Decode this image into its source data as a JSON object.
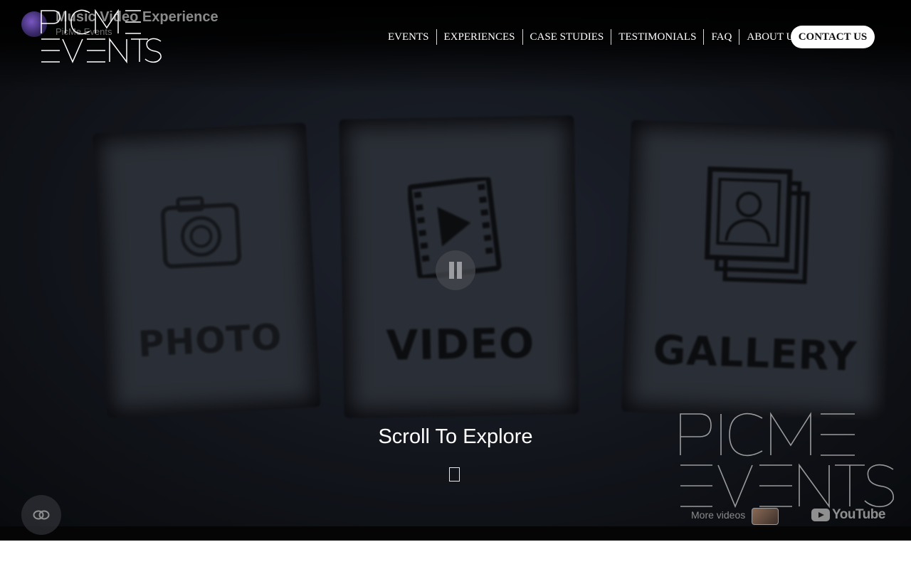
{
  "header": {
    "logo_text_top": "PICME",
    "logo_text_bottom": "EVENTS",
    "nav": [
      "EVENTS",
      "EXPERIENCES",
      "CASE STUDIES",
      "TESTIMONIALS",
      "FAQ",
      "ABOUT US"
    ],
    "contact_label": "CONTACT US"
  },
  "video": {
    "title": "Music Video Experience",
    "channel": "PicMe Events",
    "card_words": [
      "PHOTO",
      "VIDEO",
      "GALLERY"
    ],
    "scroll_text": "Scroll To Explore",
    "more_videos": "More videos",
    "youtube_word": "YouTube",
    "watermark_top": "PICME",
    "watermark_bottom": "EVENTS"
  },
  "icons": {
    "pause": "pause-icon",
    "scroll": "scroll-down-icon",
    "link": "link-icon",
    "youtube": "youtube-logo-icon"
  }
}
